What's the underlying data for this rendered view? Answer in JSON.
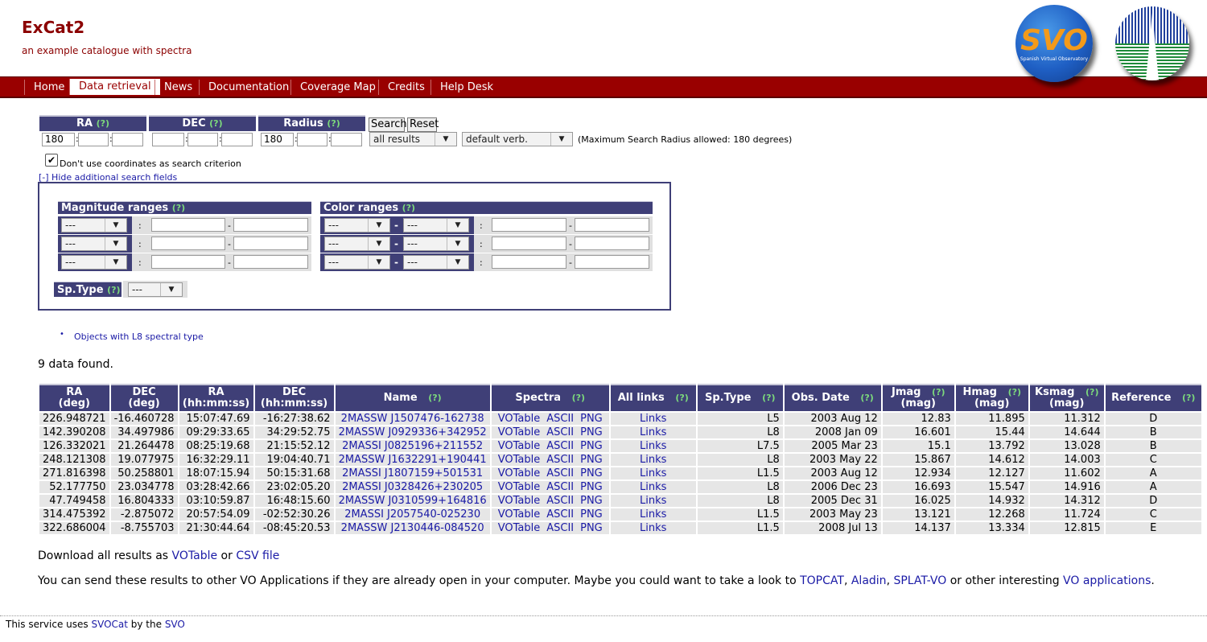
{
  "site": {
    "title": "ExCat2",
    "subtitle": "an example catalogue with spectra",
    "logo_text": "SVO",
    "logo_subtext": "Spanish Virtual Observatory"
  },
  "nav": [
    "Home",
    "Data retrieval",
    "News",
    "Documentation",
    "Coverage Map",
    "Credits",
    "Help Desk"
  ],
  "search": {
    "ra_label": "RA",
    "dec_label": "DEC",
    "radius_label": "Radius",
    "help": "(?)",
    "ra_value": "180",
    "radius_value": "180",
    "search_button": "Search",
    "reset_button": "Reset",
    "results_select": "all results",
    "verb_select": "default verb.",
    "max_radius_note": "(Maximum Search Radius allowed: 180 degrees)",
    "nocoord_label": "Don't use coordinates as search criterion",
    "hide_link": "[-] Hide additional search fields",
    "mag_ranges_label": "Magnitude ranges",
    "color_ranges_label": "Color ranges",
    "sptype_label": "Sp.Type",
    "dash_option": "---"
  },
  "examples": [
    "Objects with L8 spectral type"
  ],
  "found_text": "9 data found.",
  "table": {
    "headers": [
      {
        "top": "RA",
        "bottom": "(deg)"
      },
      {
        "top": "DEC",
        "bottom": "(deg)"
      },
      {
        "top": "RA",
        "bottom": "(hh:mm:ss)"
      },
      {
        "top": "DEC",
        "bottom": "(hh:mm:ss)"
      },
      {
        "top": "Name",
        "help": "(?)"
      },
      {
        "top": "Spectra",
        "help": "(?)"
      },
      {
        "top": "All links",
        "help": "(?)"
      },
      {
        "top": "Sp.Type",
        "help": "(?)"
      },
      {
        "top": "Obs. Date",
        "help": "(?)"
      },
      {
        "top": "Jmag",
        "help": "(?)",
        "bottom": "(mag)"
      },
      {
        "top": "Hmag",
        "help": "(?)",
        "bottom": "(mag)"
      },
      {
        "top": "Ksmag",
        "help": "(?)",
        "bottom": "(mag)"
      },
      {
        "top": "Reference",
        "help": "(?)"
      }
    ],
    "spectra_links": [
      "VOTable",
      "ASCII",
      "PNG"
    ],
    "links_label": "Links",
    "rows": [
      [
        "226.948721",
        "-16.460728",
        "15:07:47.69",
        "-16:27:38.62",
        "2MASSW J1507476-162738",
        "L5",
        "2003 Aug 12",
        "12.83",
        "11.895",
        "11.312",
        "D"
      ],
      [
        "142.390208",
        "34.497986",
        "09:29:33.65",
        "34:29:52.75",
        "2MASSW J0929336+342952",
        "L8",
        "2008 Jan 09",
        "16.601",
        "15.44",
        "14.644",
        "B"
      ],
      [
        "126.332021",
        "21.264478",
        "08:25:19.68",
        "21:15:52.12",
        "2MASSI J0825196+211552",
        "L7.5",
        "2005 Mar 23",
        "15.1",
        "13.792",
        "13.028",
        "B"
      ],
      [
        "248.121308",
        "19.077975",
        "16:32:29.11",
        "19:04:40.71",
        "2MASSW J1632291+190441",
        "L8",
        "2003 May 22",
        "15.867",
        "14.612",
        "14.003",
        "C"
      ],
      [
        "271.816398",
        "50.258801",
        "18:07:15.94",
        "50:15:31.68",
        "2MASSI J1807159+501531",
        "L1.5",
        "2003 Aug 12",
        "12.934",
        "12.127",
        "11.602",
        "A"
      ],
      [
        "52.177750",
        "23.034778",
        "03:28:42.66",
        "23:02:05.20",
        "2MASSI J0328426+230205",
        "L8",
        "2006 Dec 23",
        "16.693",
        "15.547",
        "14.916",
        "A"
      ],
      [
        "47.749458",
        "16.804333",
        "03:10:59.87",
        "16:48:15.60",
        "2MASSW J0310599+164816",
        "L8",
        "2005 Dec 31",
        "16.025",
        "14.932",
        "14.312",
        "D"
      ],
      [
        "314.475392",
        "-2.875072",
        "20:57:54.09",
        "-02:52:30.26",
        "2MASSI J2057540-025230",
        "L1.5",
        "2003 May 23",
        "13.121",
        "12.268",
        "11.724",
        "C"
      ],
      [
        "322.686004",
        "-8.755703",
        "21:30:44.64",
        "-08:45:20.53",
        "2MASSW J2130446-084520",
        "L1.5",
        "2008 Jul 13",
        "14.137",
        "13.334",
        "12.815",
        "E"
      ]
    ]
  },
  "download": {
    "prefix": "Download all results as ",
    "votable": "VOTable",
    "or": " or ",
    "csv": "CSV file"
  },
  "vo": {
    "text": "You can send these results to other VO Applications if they are already open in your computer. Maybe you could want to take a look to ",
    "topcat": "TOPCAT",
    "aladin": "Aladin",
    "splat": "SPLAT-VO",
    "middle": " or other interesting ",
    "vo_apps": "VO applications",
    "end": "."
  },
  "footer": {
    "prefix": "This service uses ",
    "svocat": "SVOCat",
    "middle": " by the ",
    "svo": "SVO"
  }
}
